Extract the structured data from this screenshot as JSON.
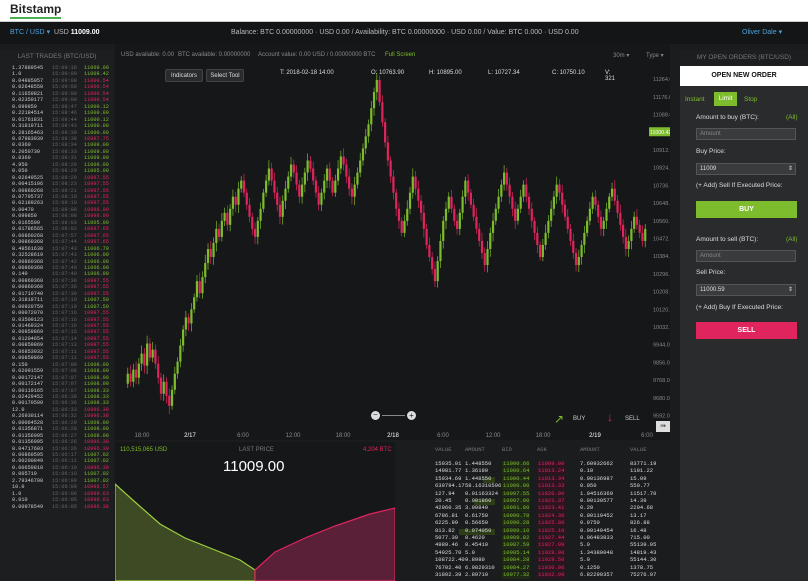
{
  "brand": "Bitstamp",
  "header": {
    "pair": "BTC / USD",
    "pair_price_label": "USD",
    "pair_price": "11009.00",
    "balance": "Balance: BTC 0.00000000 · USD 0.00 / Availability: BTC 0.00000000 · USD 0.00 / Value: BTC 0.000 · USD 0.00",
    "user": "Oliver Dale"
  },
  "trades": {
    "title": "LAST TRADES (BTC/USD)",
    "rows": [
      [
        "1.37889545",
        "15:09:16",
        "11009.00",
        "up"
      ],
      [
        "1.0",
        "15:09:00",
        "11009.42",
        "up"
      ],
      [
        "0.04885057",
        "15:09:00",
        "11000.54",
        "dn"
      ],
      [
        "0.02648550",
        "15:09:00",
        "11000.54",
        "dn"
      ],
      [
        "0.11659821",
        "15:09:00",
        "11000.54",
        "dn"
      ],
      [
        "0.02350177",
        "15:09:00",
        "11000.54",
        "dn"
      ],
      [
        "0.099850",
        "15:08:47",
        "11000.12",
        "up"
      ],
      [
        "0.22184514",
        "15:08:46",
        "11000.00",
        "up"
      ],
      [
        "0.01761831",
        "15:08:44",
        "11000.12",
        "up"
      ],
      [
        "0.31819711",
        "15:08:43",
        "11000.00",
        "up"
      ],
      [
        "0.28165463",
        "15:08:39",
        "11000.00",
        "up"
      ],
      [
        "0.07983939",
        "15:08:38",
        "10997.75",
        "dn"
      ],
      [
        "0.0360",
        "15:08:34",
        "11009.00",
        "up"
      ],
      [
        "0.2050730",
        "15:08:33",
        "11009.00",
        "up"
      ],
      [
        "0.0360",
        "15:08:31",
        "11009.00",
        "up"
      ],
      [
        "4.950",
        "15:08:29",
        "11009.00",
        "up"
      ],
      [
        "0.050",
        "15:08:29",
        "11005.00",
        "up"
      ],
      [
        "0.02649525",
        "15:08:29",
        "10997.55",
        "dn"
      ],
      [
        "0.00415106",
        "15:08:23",
        "10997.55",
        "dn"
      ],
      [
        "0.00860268",
        "15:08:21",
        "10997.55",
        "dn"
      ],
      [
        "0.07795737",
        "15:08:19",
        "10997.55",
        "dn"
      ],
      [
        "0.02189263",
        "15:08:10",
        "10997.55",
        "dn"
      ],
      [
        "0.00470",
        "15:08:08",
        "10998.90",
        "dn"
      ],
      [
        "0.099850",
        "15:08:08",
        "10998.90",
        "dn"
      ],
      [
        "0.0165590",
        "15:08:03",
        "11005.00",
        "up"
      ],
      [
        "0.01786565",
        "15:08:02",
        "10997.65",
        "dn"
      ],
      [
        "0.00860268",
        "15:07:57",
        "10997.65",
        "dn"
      ],
      [
        "0.00860368",
        "15:07:44",
        "10997.65",
        "dn"
      ],
      [
        "0.49561630",
        "15:07:43",
        "11006.79",
        "up"
      ],
      [
        "0.32528619",
        "15:07:43",
        "11006.00",
        "up"
      ],
      [
        "0.00860368",
        "15:07:42",
        "11006.00",
        "up"
      ],
      [
        "0.00860368",
        "15:07:40",
        "11006.00",
        "up"
      ],
      [
        "0.140",
        "15:07:40",
        "11006.00",
        "up"
      ],
      [
        "0.00860368",
        "15:07:38",
        "10997.55",
        "dn"
      ],
      [
        "0.00860368",
        "15:07:36",
        "10997.55",
        "dn"
      ],
      [
        "0.01719740",
        "15:07:30",
        "10997.55",
        "dn"
      ],
      [
        "0.31819711",
        "15:07:19",
        "11007.50",
        "up"
      ],
      [
        "0.00920759",
        "15:07:19",
        "11007.50",
        "up"
      ],
      [
        "0.00072070",
        "15:07:16",
        "10997.55",
        "dn"
      ],
      [
        "0.03509123",
        "15:07:16",
        "10997.55",
        "dn"
      ],
      [
        "0.01469324",
        "15:07:16",
        "10997.55",
        "dn"
      ],
      [
        "0.00859869",
        "15:07:15",
        "10997.55",
        "dn"
      ],
      [
        "0.01204654",
        "15:07:14",
        "10997.55",
        "dn"
      ],
      [
        "0.00859869",
        "15:07:13",
        "10997.55",
        "dn"
      ],
      [
        "0.06853932",
        "15:07:11",
        "10997.55",
        "dn"
      ],
      [
        "0.00859869",
        "15:07:11",
        "10997.55",
        "dn"
      ],
      [
        "0.150",
        "15:07:08",
        "11008.00",
        "up"
      ],
      [
        "0.02091559",
        "15:07:08",
        "11008.00",
        "up"
      ],
      [
        "0.00172147",
        "15:07:07",
        "11008.00",
        "up"
      ],
      [
        "0.00172147",
        "15:07:07",
        "11008.00",
        "up"
      ],
      [
        "0.00119165",
        "15:07:07",
        "11008.33",
        "up"
      ],
      [
        "0.02429452",
        "15:06:38",
        "11008.33",
        "up"
      ],
      [
        "0.00170500",
        "15:06:36",
        "11008.33",
        "up"
      ],
      [
        "12.0",
        "15:06:33",
        "10996.38",
        "dn"
      ],
      [
        "0.26930114",
        "15:06:32",
        "10996.38",
        "dn"
      ],
      [
        "0.00064528",
        "15:06:29",
        "11008.00",
        "up"
      ],
      [
        "0.01356871",
        "15:06:28",
        "11008.00",
        "up"
      ],
      [
        "0.01356095",
        "15:06:27",
        "11008.00",
        "up"
      ],
      [
        "0.01356095",
        "15:06:26",
        "10996.38",
        "dn"
      ],
      [
        "0.04717603",
        "15:06:26",
        "10996.39",
        "dn"
      ],
      [
        "0.00860595",
        "15:06:17",
        "11007.02",
        "up"
      ],
      [
        "0.00200849",
        "15:06:11",
        "11007.02",
        "up"
      ],
      [
        "0.00659818",
        "15:06:10",
        "10996.39",
        "dn"
      ],
      [
        "0.005710",
        "15:06:10",
        "11007.02",
        "up"
      ],
      [
        "2.79346798",
        "15:06:09",
        "11007.02",
        "up"
      ],
      [
        "10.0",
        "15:06:09",
        "10996.57",
        "dn"
      ],
      [
        "1.0",
        "15:06:06",
        "10999.63",
        "dn"
      ],
      [
        "0.010",
        "15:06:05",
        "10999.63",
        "dn"
      ],
      [
        "0.00978549",
        "15:06:05",
        "10996.38",
        "dn"
      ]
    ]
  },
  "chart": {
    "usd_available": "USD available: 0.00",
    "btc_available": "BTC available: 0.00000000",
    "account_value": "Account value: 0.00 USD / 0.00000000 BTC",
    "full_screen": "Full Screen",
    "interval": "30m",
    "type_label": "Type",
    "indicators": "Indicators",
    "select_tool": "Select Tool",
    "ohlc": {
      "time": "T: 2018-02-18 14:00",
      "open": "O: 10763.90",
      "high": "H: 10895.00",
      "low": "L: 10727.34",
      "close": "C: 10750.10",
      "volume": "V: 321"
    },
    "buy_label": "BUY",
    "sell_label": "SELL",
    "current_price_tag": "11000.42"
  },
  "chart_data": {
    "type": "candlestick",
    "ylim": [
      9520,
      11290
    ],
    "y_ticks": [
      "11264.00",
      "11176.00",
      "11088.00",
      "11000.00",
      "10912.00",
      "10824.00",
      "10736.00",
      "10648.00",
      "10560.00",
      "10472.00",
      "10384.00",
      "10296.00",
      "10208.00",
      "10120.00",
      "10032.00",
      "9944.00",
      "9856.00",
      "9768.00",
      "9680.00",
      "9592.00"
    ],
    "x_ticks": [
      "18:00",
      "2/17",
      "6:00",
      "12:00",
      "18:00",
      "2/18",
      "6:00",
      "12:00",
      "18:00",
      "2/19",
      "6:00"
    ],
    "closes": [
      9750,
      9800,
      9760,
      9820,
      9780,
      9850,
      9900,
      9840,
      9950,
      9880,
      9920,
      9850,
      9780,
      9700,
      9760,
      9690,
      9640,
      9720,
      9800,
      9860,
      9940,
      10020,
      10080,
      10050,
      10120,
      10180,
      10260,
      10200,
      10280,
      10350,
      10420,
      10380,
      10450,
      10520,
      10480,
      10560,
      10600,
      10540,
      10620,
      10680,
      10640,
      10720,
      10760,
      10700,
      10640,
      10580,
      10520,
      10480,
      10560,
      10620,
      10700,
      10760,
      10820,
      10760,
      10700,
      10640,
      10580,
      10660,
      10720,
      10780,
      10840,
      10800,
      10740,
      10680,
      10740,
      10800,
      10860,
      10820,
      10760,
      10700,
      10640,
      10700,
      10760,
      10820,
      10760,
      10700,
      10760,
      10820,
      10880,
      10840,
      10780,
      10720,
      10680,
      10740,
      10800,
      10860,
      10920,
      10980,
      11040,
      11120,
      11200,
      11260,
      11150,
      11050,
      10950,
      10860,
      10780,
      10700,
      10620,
      10560,
      10500,
      10560,
      10620,
      10700,
      10780,
      10720,
      10660,
      10600,
      10520,
      10440,
      10380,
      10320,
      10260,
      10360,
      10460,
      10560,
      10620,
      10680,
      10620,
      10560,
      10520,
      10600,
      10680,
      10760,
      10700,
      10640,
      10580,
      10520,
      10460,
      10400,
      10340,
      10420,
      10500,
      10560,
      10620,
      10680,
      10740,
      10800,
      10740,
      10680,
      10620,
      10560,
      10620,
      10680,
      10740,
      10680,
      10620,
      10560,
      10500,
      10440,
      10380,
      10440,
      10500,
      10560,
      10620,
      10680,
      10740,
      10700,
      10640,
      10580,
      10520,
      10460,
      10400,
      10340,
      10380,
      10440,
      10500,
      10560,
      10620,
      10680,
      10640,
      10580,
      10520,
      10560,
      10620,
      10680,
      10720,
      10660,
      10600,
      10540,
      10480,
      10420,
      10460,
      10520,
      10580,
      10540,
      10500,
      10460,
      10520
    ]
  },
  "depth": {
    "bids_total": "110,515,065 USD",
    "last_price_label": "LAST PRICE",
    "last_price": "11009.00",
    "asks_total": "4,204 BTC"
  },
  "orderbook": {
    "headers": [
      "VALUE",
      "AMOUNT",
      "BID",
      "ASK",
      "AMOUNT",
      "VALUE"
    ],
    "rows": [
      [
        "15935.01",
        "1.448550",
        "11000.66",
        "11009.00",
        "7.60932662",
        "83771.19"
      ],
      [
        "14981.77",
        "1.36190",
        "11000.64",
        "11013.24",
        "0.10",
        "1101.22"
      ],
      [
        "15934.69",
        "1.448550",
        "11000.44",
        "11013.34",
        "0.00136987",
        "15.09"
      ],
      [
        "639794.17",
        "58.16310596",
        "11000.00",
        "11013.33",
        "0.050",
        "550.77"
      ],
      [
        "127.94",
        "0.01163324",
        "10997.55",
        "11020.00",
        "1.04516369",
        "11517.70"
      ],
      [
        "20.45",
        "0.001860",
        "10997.00",
        "11021.37",
        "0.00130577",
        "14.39"
      ],
      [
        "42960.35",
        "3.90840",
        "10991.80",
        "11023.41",
        "0.20",
        "2204.68"
      ],
      [
        "6786.81",
        "0.61750",
        "10990.78",
        "11024.36",
        "0.00119452",
        "13.17"
      ],
      [
        "6225.99",
        "0.56650",
        "10990.28",
        "11025.00",
        "0.0750",
        "826.88"
      ],
      [
        "813.82",
        "0.074050",
        "10990.10",
        "11025.10",
        "0.00149454",
        "16.48"
      ],
      [
        "5077.30",
        "0.4620",
        "10989.82",
        "11027.44",
        "0.06483833",
        "715.00"
      ],
      [
        "4989.46",
        "0.45410",
        "10987.59",
        "11027.99",
        "5.0",
        "55139.95"
      ],
      [
        "54925.70",
        "5.0",
        "10985.14",
        "11028.00",
        "1.34380048",
        "14819.43"
      ],
      [
        "108722.40",
        "9.8980",
        "10984.28",
        "11028.50",
        "5.0",
        "55144.30"
      ],
      [
        "76702.40",
        "6.9829310",
        "10984.27",
        "11030.00",
        "0.1250",
        "1378.75"
      ],
      [
        "31802.39",
        "2.89710",
        "10977.32",
        "11032.99",
        "6.82290357",
        "75276.07"
      ]
    ]
  },
  "order_form": {
    "title": "MY OPEN ORDERS (BTC/USD)",
    "open_new": "OPEN NEW ORDER",
    "tabs": [
      "Instant",
      "Limit",
      "Stop"
    ],
    "amount_buy_label": "Amount to buy (BTC):",
    "all_label": "(All)",
    "amount_placeholder": "Amount",
    "buy_price_label": "Buy Price:",
    "buy_price": "11009",
    "add_sell_label": "(+ Add) Sell If Executed Price:",
    "buy_button": "BUY",
    "amount_sell_label": "Amount to sell (BTC):",
    "sell_price_label": "Sell Price:",
    "sell_price": "11000.59",
    "add_buy_label": "(+ Add) Buy If Executed Price:",
    "sell_button": "SELL"
  },
  "colors": {
    "up": "#7dbd2d",
    "down": "#e0245e",
    "accent": "#4aa3df",
    "buy": "#7dbd2d",
    "sell": "#e0245e"
  }
}
